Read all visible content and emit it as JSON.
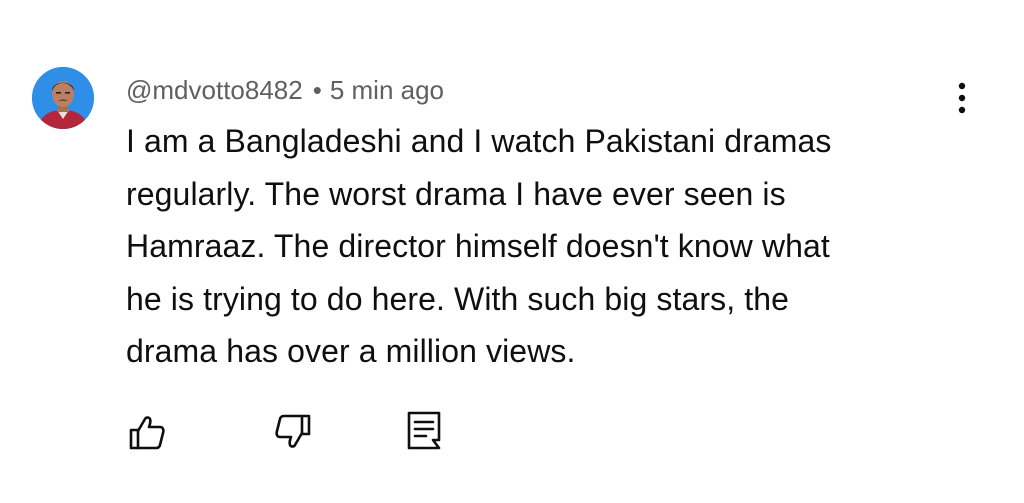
{
  "comment": {
    "author": "@mdvotto8482",
    "separator": "•",
    "time": "5 min ago",
    "lines": [
      "I am a Bangladeshi and I watch Pakistani dramas",
      "regularly. The worst drama I have ever seen is",
      "Hamraaz. The director himself doesn't know what",
      "he is trying to do here. With such big stars, the",
      "drama has over a million views."
    ],
    "avatar_icon": "user-avatar",
    "menu_icon": "more-vert-icon"
  },
  "actions": {
    "like_icon": "thumb-up-icon",
    "dislike_icon": "thumb-down-icon",
    "reply_icon": "reply-comment-icon"
  },
  "colors": {
    "text_primary": "#0f0f0f",
    "text_secondary": "#606060",
    "avatar_bg": "#2f8fe8",
    "shirt": "#b3263b"
  }
}
